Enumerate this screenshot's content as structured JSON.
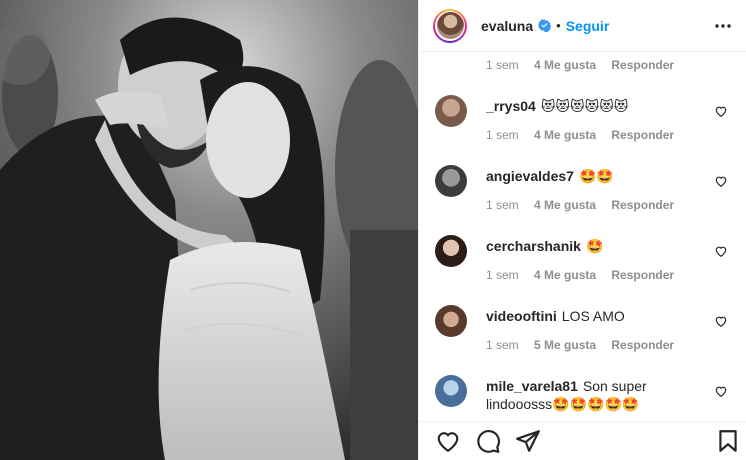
{
  "post": {
    "image_desc_icon": "wedding-photo",
    "author": "evaluna",
    "follow_label": "Seguir",
    "separator": "•"
  },
  "first_meta": {
    "time": "1 sem",
    "likes": "4 Me gusta",
    "reply": "Responder"
  },
  "comments": [
    {
      "user": "_rrys04",
      "text": "😻😻😻😻😻😻",
      "time": "1 sem",
      "likes": "4 Me gusta",
      "reply": "Responder"
    },
    {
      "user": "angievaldes7",
      "text": "🤩🤩",
      "time": "1 sem",
      "likes": "4 Me gusta",
      "reply": "Responder"
    },
    {
      "user": "cercharshanik",
      "text": "🤩",
      "time": "1 sem",
      "likes": "4 Me gusta",
      "reply": "Responder"
    },
    {
      "user": "videooftini",
      "text": "LOS AMO",
      "time": "1 sem",
      "likes": "5 Me gusta",
      "reply": "Responder"
    },
    {
      "user": "mile_varela81",
      "text": "Son super lindooosss🤩🤩🤩🤩🤩",
      "time": "",
      "likes": "",
      "reply": ""
    }
  ],
  "colors": {
    "accent": "#0095f6",
    "muted": "#8e8e8e",
    "text": "#262626",
    "border": "#efefef"
  },
  "icons": [
    "heart-icon",
    "comment-icon",
    "share-icon",
    "bookmark-icon",
    "more-options-icon",
    "verified-badge-icon"
  ]
}
